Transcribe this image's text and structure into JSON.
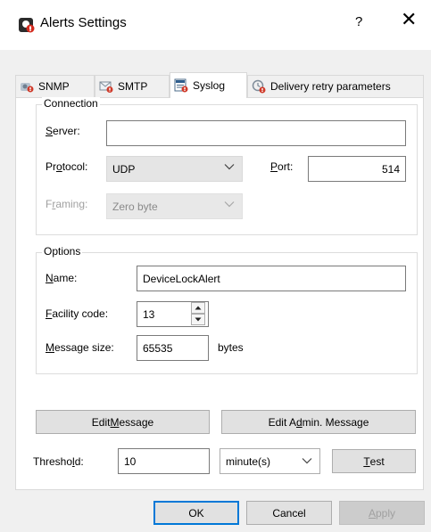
{
  "window": {
    "title": "Alerts Settings",
    "help_glyph": "?",
    "close_glyph": "✕"
  },
  "tabs": [
    {
      "label": "SNMP",
      "icon": "snmp-icon"
    },
    {
      "label": "SMTP",
      "icon": "envelope-icon"
    },
    {
      "label": "Syslog",
      "icon": "syslog-log-icon",
      "active": true
    },
    {
      "label": "Delivery retry parameters",
      "icon": "retry-icon"
    }
  ],
  "connection": {
    "legend": "Connection",
    "server_label_u": "S",
    "server_label_rest": "erver:",
    "server_value": "",
    "protocol_label_pre": "Pr",
    "protocol_label_u": "o",
    "protocol_label_rest": "tocol:",
    "protocol_value": "UDP",
    "port_label_u": "P",
    "port_label_rest": "ort:",
    "port_value": "514",
    "framing_label_pre": "F",
    "framing_label_u": "r",
    "framing_label_rest": "aming:",
    "framing_value": "Zero byte"
  },
  "options": {
    "legend": "Options",
    "name_label_u": "N",
    "name_label_rest": "ame:",
    "name_value": "DeviceLockAlert",
    "facility_label_u": "F",
    "facility_label_rest": "acility code:",
    "facility_value": "13",
    "msgsize_label_u": "M",
    "msgsize_label_rest": "essage size:",
    "msgsize_value": "65535",
    "msgsize_unit": "bytes"
  },
  "actions": {
    "edit_message_pre": "Edit ",
    "edit_message_u": "M",
    "edit_message_rest": "essage",
    "edit_admin_pre": "Edit A",
    "edit_admin_u": "d",
    "edit_admin_rest": "min. Message",
    "threshold_label_pre": "Thresho",
    "threshold_label_u": "l",
    "threshold_label_rest": "d:",
    "threshold_value": "10",
    "threshold_unit": "minute(s)",
    "test_u": "T",
    "test_rest": "est"
  },
  "footer": {
    "ok": "OK",
    "cancel": "Cancel",
    "apply_u": "A",
    "apply_rest": "pply"
  }
}
